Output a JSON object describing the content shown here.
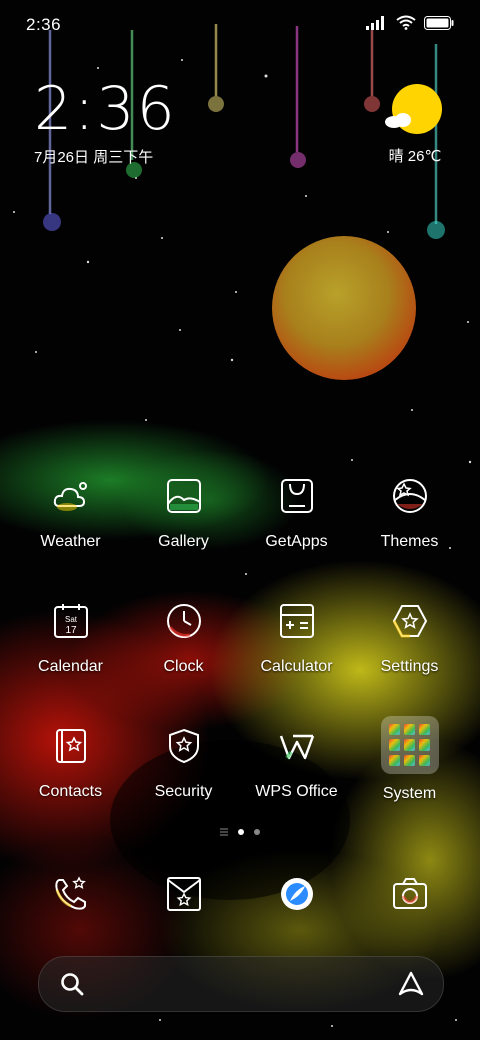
{
  "status_bar": {
    "time": "2:36",
    "icons": [
      "signal-icon",
      "wifi-icon",
      "battery-icon"
    ]
  },
  "clock_widget": {
    "time": "2:36",
    "date": "7月26日 周三下午"
  },
  "weather_widget": {
    "text": "晴 26℃",
    "icon": "sunny-icon"
  },
  "app_grid": {
    "rows": [
      [
        {
          "label": "Weather",
          "icon": "weather-icon"
        },
        {
          "label": "Gallery",
          "icon": "gallery-icon"
        },
        {
          "label": "GetApps",
          "icon": "getapps-icon"
        },
        {
          "label": "Themes",
          "icon": "themes-icon"
        }
      ],
      [
        {
          "label": "Calendar",
          "icon": "calendar-icon",
          "sub": "Sat",
          "day": "17"
        },
        {
          "label": "Clock",
          "icon": "clock-icon"
        },
        {
          "label": "Calculator",
          "icon": "calculator-icon"
        },
        {
          "label": "Settings",
          "icon": "settings-icon"
        }
      ],
      [
        {
          "label": "Contacts",
          "icon": "contacts-icon"
        },
        {
          "label": "Security",
          "icon": "security-icon"
        },
        {
          "label": "WPS Office",
          "icon": "wps-office-icon"
        },
        {
          "label": "System",
          "icon": "folder-icon"
        }
      ]
    ]
  },
  "page_indicator": {
    "pages": 2,
    "current": 1
  },
  "dock": [
    {
      "name": "phone",
      "icon": "phone-icon"
    },
    {
      "name": "messages",
      "icon": "messages-icon"
    },
    {
      "name": "browser",
      "icon": "browser-icon"
    },
    {
      "name": "camera",
      "icon": "camera-icon"
    }
  ],
  "search_bar": {
    "left_icon": "search-icon",
    "right_icon": "assistant-icon"
  },
  "colors": {
    "sun": "#ffd400",
    "accent_gradient": [
      "#ff3b30",
      "#ffcc00",
      "#34c759",
      "#5ac8fa"
    ]
  }
}
